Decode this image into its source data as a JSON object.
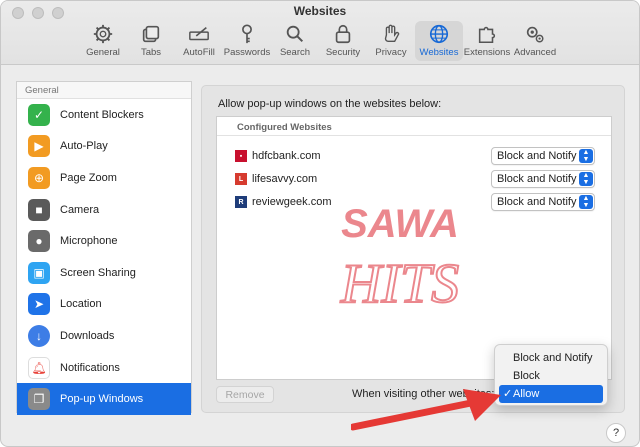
{
  "window": {
    "title": "Websites"
  },
  "toolbar": {
    "items": [
      {
        "label": "General",
        "icon": "gear-icon"
      },
      {
        "label": "Tabs",
        "icon": "tabs-icon"
      },
      {
        "label": "AutoFill",
        "icon": "autofill-icon"
      },
      {
        "label": "Passwords",
        "icon": "key-icon"
      },
      {
        "label": "Search",
        "icon": "search-icon"
      },
      {
        "label": "Security",
        "icon": "lock-icon"
      },
      {
        "label": "Privacy",
        "icon": "hand-icon"
      },
      {
        "label": "Websites",
        "icon": "globe-icon",
        "active": true
      },
      {
        "label": "Extensions",
        "icon": "extensions-icon"
      },
      {
        "label": "Advanced",
        "icon": "advanced-gears-icon"
      }
    ]
  },
  "sidebar": {
    "header": "General",
    "items": [
      {
        "label": "Content Blockers",
        "icon": "shield-check-icon",
        "color": "#34b24c"
      },
      {
        "label": "Auto-Play",
        "icon": "play-icon",
        "color": "#f29b22"
      },
      {
        "label": "Page Zoom",
        "icon": "zoom-icon",
        "color": "#f29b22"
      },
      {
        "label": "Camera",
        "icon": "camera-icon",
        "color": "#5a5a5a"
      },
      {
        "label": "Microphone",
        "icon": "microphone-icon",
        "color": "#6a6a6a"
      },
      {
        "label": "Screen Sharing",
        "icon": "screen-sharing-icon",
        "color": "#2ea4f2"
      },
      {
        "label": "Location",
        "icon": "location-arrow-icon",
        "color": "#1f73e8"
      },
      {
        "label": "Downloads",
        "icon": "download-icon",
        "color": "#3d7de6"
      },
      {
        "label": "Notifications",
        "icon": "bell-icon",
        "color": "#e8423a"
      },
      {
        "label": "Pop-up Windows",
        "icon": "popup-windows-icon",
        "color": "#8a8a8a",
        "selected": true
      }
    ]
  },
  "main": {
    "caption": "Allow pop-up windows on the websites below:",
    "table_header": "Configured Websites",
    "sites": [
      {
        "name": "hdfcbank.com",
        "setting": "Block and Notify",
        "favicon": "hdfc-favicon",
        "favicon_color": "#c8102e"
      },
      {
        "name": "lifesavvy.com",
        "setting": "Block and Notify",
        "favicon": "lifesavvy-favicon",
        "favicon_color": "#d63b2f"
      },
      {
        "name": "reviewgeek.com",
        "setting": "Block and Notify",
        "favicon": "reviewgeek-favicon",
        "favicon_color": "#1f3d7a"
      }
    ],
    "remove_button": "Remove",
    "other_websites_label": "When visiting other websites:"
  },
  "dropdown": {
    "options": [
      "Block and Notify",
      "Block",
      "Allow"
    ],
    "selected": "Allow"
  },
  "watermark": {
    "line1": "SAWA",
    "line2": "HITS",
    "color": "#e8737a"
  },
  "help_button": "?",
  "colors": {
    "accent": "#1a6ee3",
    "annotation_arrow": "#e53935"
  }
}
